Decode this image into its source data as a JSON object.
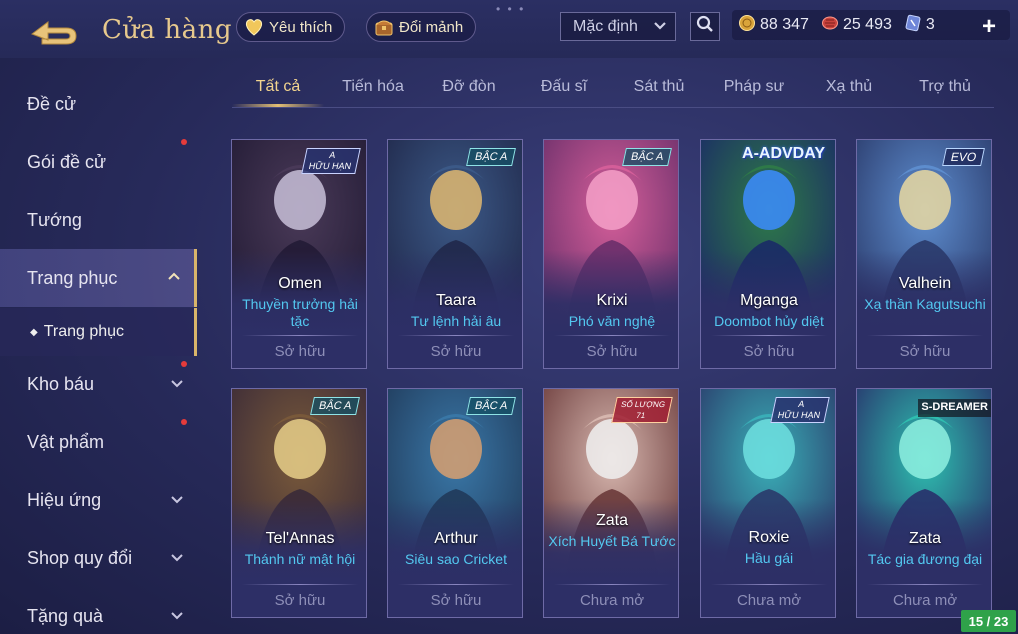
{
  "header": {
    "title": "Cửa hàng",
    "favorite_label": "Yêu thích",
    "exchange_label": "Đổi mảnh",
    "sort_value": "Mặc định",
    "currency": {
      "gold": "88 347",
      "vouchers": "25 493",
      "tickets": "3"
    }
  },
  "sidebar": {
    "items": [
      {
        "label": "Đề cử"
      },
      {
        "label": "Gói đề cử"
      },
      {
        "label": "Tướng"
      },
      {
        "label": "Trang phục"
      },
      {
        "label": "Kho báu"
      },
      {
        "label": "Vật phẩm"
      },
      {
        "label": "Hiệu ứng"
      },
      {
        "label": "Shop quy đổi"
      },
      {
        "label": "Tặng quà"
      }
    ],
    "sub_item": "Trang phục"
  },
  "tabs": [
    "Tất cả",
    "Tiến hóa",
    "Đỡ đòn",
    "Đấu sĩ",
    "Sát thủ",
    "Pháp sư",
    "Xạ thủ",
    "Trợ thủ"
  ],
  "cards": [
    {
      "hero": "Omen",
      "skin": "Thuyền trưởng hải tặc",
      "status": "Sở hữu",
      "badge": "A\nHỮU HẠN",
      "badge_type": "limited",
      "art": "omen-art"
    },
    {
      "hero": "Taara",
      "skin": "Tư lệnh hải âu",
      "status": "Sở hữu",
      "badge": "BẬC A",
      "badge_type": "grade",
      "art": "taara-art"
    },
    {
      "hero": "Krixi",
      "skin": "Phó văn nghệ",
      "status": "Sở hữu",
      "badge": "BẬC A",
      "badge_type": "grade",
      "art": "krixi-art"
    },
    {
      "hero": "Mganga",
      "skin": "Doombot hủy diệt",
      "status": "Sở hữu",
      "badge": "A-ADVDAY",
      "badge_type": "adv",
      "art": "mganga-art"
    },
    {
      "hero": "Valhein",
      "skin": "Xạ thần Kagutsuchi",
      "status": "Sở hữu",
      "badge": "EVO",
      "badge_type": "evo",
      "art": "valhein-art"
    },
    {
      "hero": "Tel'Annas",
      "skin": "Thánh nữ mật hội",
      "status": "Sở hữu",
      "badge": "BẬC A",
      "badge_type": "grade",
      "art": "telannas-art"
    },
    {
      "hero": "Arthur",
      "skin": "Siêu sao Cricket",
      "status": "Sở hữu",
      "badge": "BẬC A",
      "badge_type": "grade",
      "art": "arthur-art"
    },
    {
      "hero": "Zata",
      "skin": "Xích Huyết Bá Tước",
      "status": "Chưa mở",
      "badge": "SỐ LƯỢNG\n71",
      "badge_type": "count",
      "art": "zata-red-art"
    },
    {
      "hero": "Roxie",
      "skin": "Hầu gái",
      "status": "Chưa mở",
      "badge": "A\nHỮU HẠN",
      "badge_type": "limited",
      "art": "roxie-art"
    },
    {
      "hero": "Zata",
      "skin": "Tác gia đương đại",
      "status": "Chưa mở",
      "badge": "S-DREAMER",
      "badge_type": "sdream",
      "art": "zata-blue-art"
    }
  ],
  "page_counter": "15 / 23"
}
